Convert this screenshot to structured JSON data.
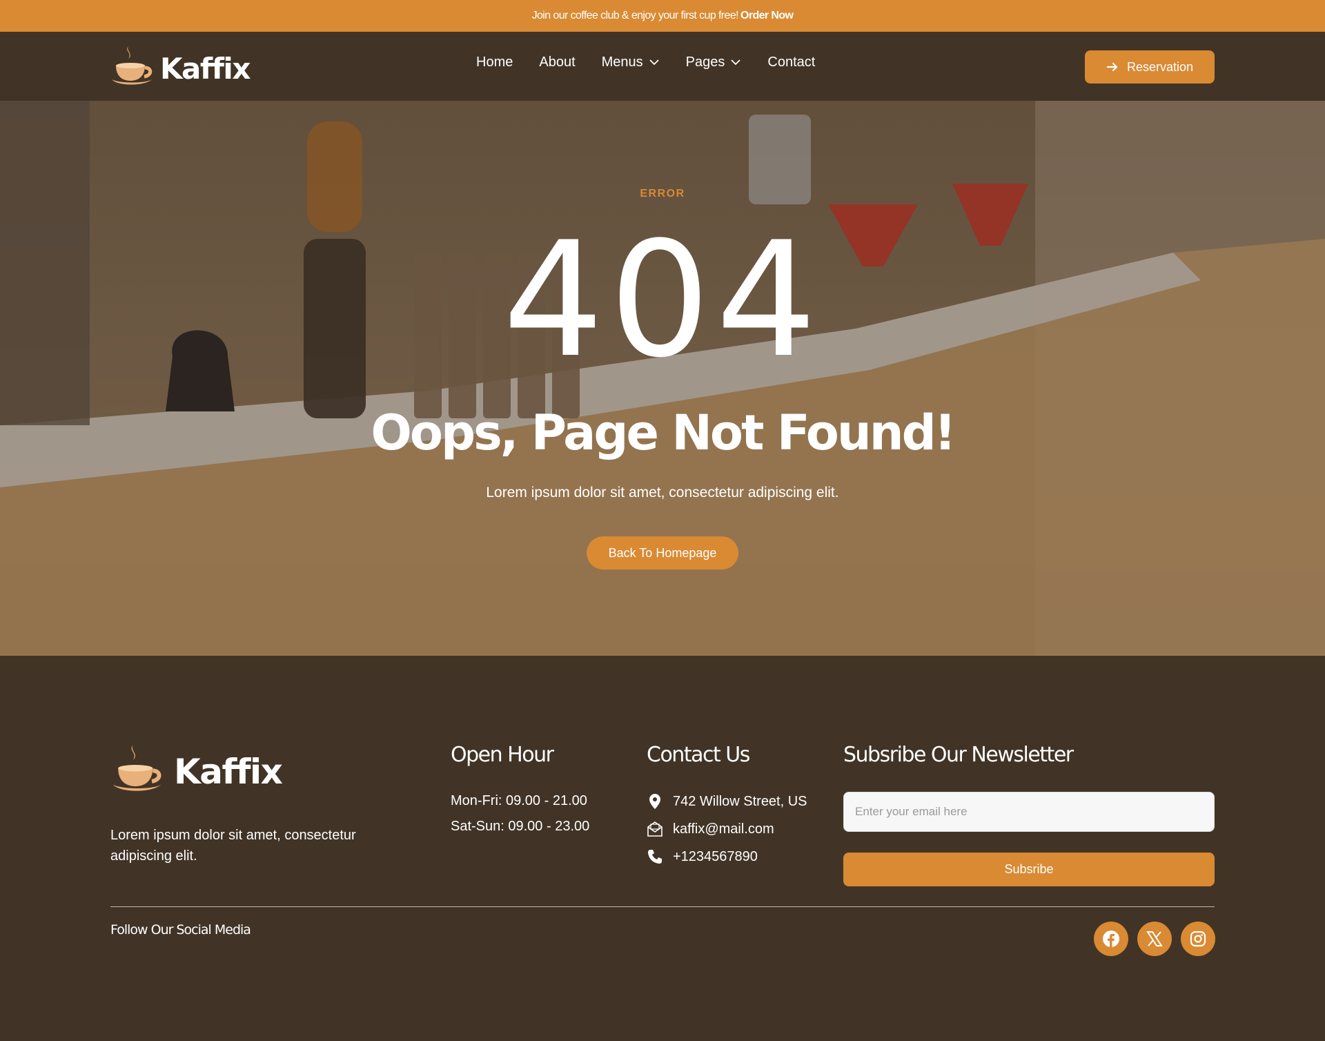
{
  "topbar": {
    "text": "Join our coffee club & enjoy your first cup free!",
    "link": "Order Now"
  },
  "brand": {
    "name": "Kaffix",
    "logo_icon": "coffee-cup-icon",
    "accent_color": "#d98a33",
    "background_color": "#413426"
  },
  "nav": {
    "items": [
      {
        "label": "Home"
      },
      {
        "label": "About"
      },
      {
        "label": "Menus",
        "icon": "chevron-down-icon"
      },
      {
        "label": "Pages",
        "icon": "chevron-down-icon"
      },
      {
        "label": "Contact"
      }
    ],
    "cta": {
      "label": "Reservation",
      "icon": "arrow-right-icon"
    }
  },
  "hero": {
    "eyebrow": "ERROR",
    "code": "404",
    "title": "Oops, Page Not Found!",
    "subtitle": "Lorem ipsum dolor sit amet, consectetur adipiscing elit.",
    "button": "Back To Homepage"
  },
  "footer": {
    "about": "Lorem ipsum dolor sit amet, consectetur adipiscing elit.",
    "open_hour": {
      "title": "Open Hour",
      "lines": [
        "Mon-Fri: 09.00 - 21.00",
        "Sat-Sun: 09.00 - 23.00"
      ]
    },
    "contact": {
      "title": "Contact Us",
      "items": [
        {
          "icon": "map-pin-icon",
          "text": "742 Willow Street, US"
        },
        {
          "icon": "mail-icon",
          "text": "kaffix@mail.com"
        },
        {
          "icon": "phone-icon",
          "text": "+1234567890"
        }
      ]
    },
    "newsletter": {
      "title": "Subsribe Our Newsletter",
      "placeholder": "Enter your email here",
      "button": "Subsribe"
    },
    "follow": "Follow Our Social Media",
    "socials": [
      "facebook-icon",
      "x-icon",
      "instagram-icon"
    ]
  }
}
